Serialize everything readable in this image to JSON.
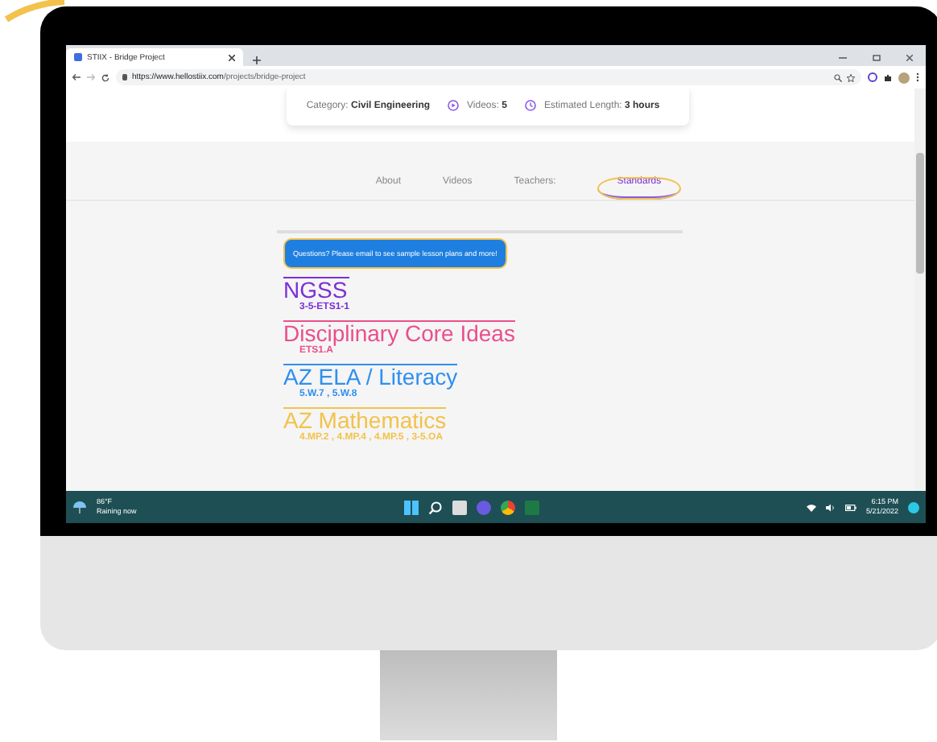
{
  "browser": {
    "tab_title": "STIIX - Bridge Project",
    "url_host": "https://www.hellostiix.com",
    "url_path": "/projects/bridge-project"
  },
  "info_card": {
    "category_label": "Category:",
    "category": "Civil Engineering",
    "videos_label": "Videos:",
    "videos": "5",
    "length_label": "Estimated Length:",
    "length": "3 hours"
  },
  "tabs": [
    {
      "label": "About",
      "selected": false
    },
    {
      "label": "Videos",
      "selected": false
    },
    {
      "label": "Teachers:",
      "selected": false
    },
    {
      "label": "Standards",
      "selected": true
    }
  ],
  "notice": "Questions? Please email to see sample lesson plans and more!",
  "standards": [
    {
      "title": "NGSS",
      "codes": "3-5-ETS1-1",
      "color": "#7b2fd6"
    },
    {
      "title": "Disciplinary Core Ideas",
      "codes": "ETS1.A",
      "color": "#ea4f8c"
    },
    {
      "title": "AZ ELA / Literacy",
      "codes": "5.W.7 , 5.W.8",
      "color": "#2f8ff0"
    },
    {
      "title": "AZ Mathematics",
      "codes": "4.MP.2 , 4.MP.4 , 4.MP.5 , 3-5.OA",
      "color": "#f3c24c"
    }
  ],
  "taskbar": {
    "temperature": "86°F",
    "weather": "Raining now",
    "time": "6:15 PM",
    "date": "5/21/2022"
  }
}
